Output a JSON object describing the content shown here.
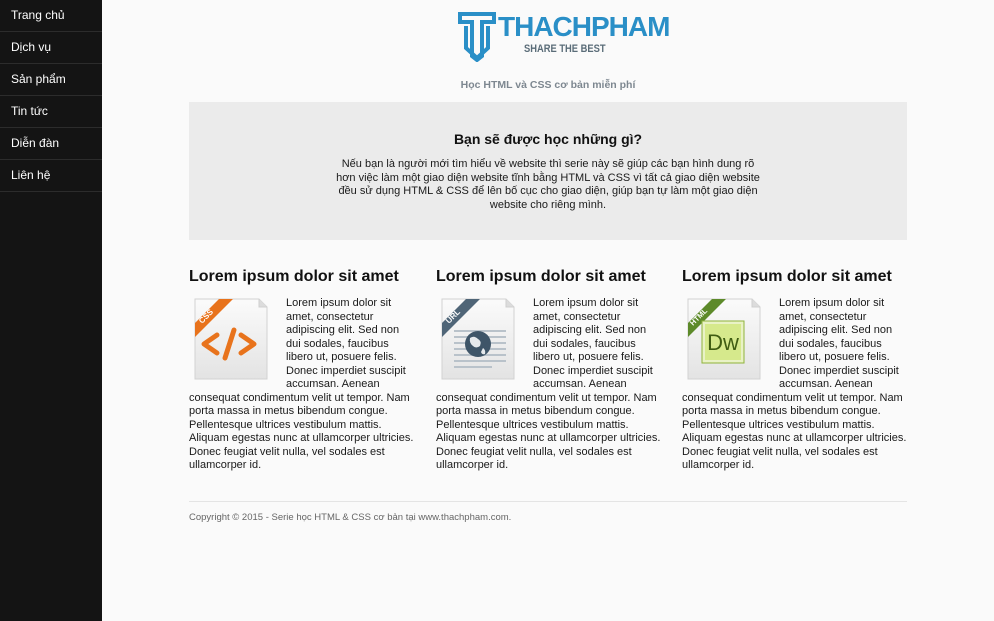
{
  "sidebar": {
    "items": [
      {
        "label": "Trang chủ"
      },
      {
        "label": "Dịch vụ"
      },
      {
        "label": "Sản phẩm"
      },
      {
        "label": "Tin tức"
      },
      {
        "label": "Diễn đàn"
      },
      {
        "label": "Liên hệ"
      }
    ]
  },
  "header": {
    "logo_brand": "THACHPHAM",
    "logo_tagline": "SHARE THE BEST",
    "subtitle": "Học HTML và CSS cơ bản miễn phí"
  },
  "intro": {
    "heading": "Bạn sẽ được học những gì?",
    "text": "Nếu bạn là người mới tìm hiểu về website thì serie này sẽ giúp các bạn hình dung rõ hơn việc làm một giao diện website tĩnh bằng HTML và CSS vì tất cả giao diện website đều sử dụng HTML & CSS để lên bố cục cho giao diện, giúp bạn tự làm một giao diện website cho riêng mình."
  },
  "columns": [
    {
      "title": "Lorem ipsum dolor sit amet",
      "icon": "css-file-icon",
      "ribbon": "CSS",
      "text": "Lorem ipsum dolor sit amet, consectetur adipiscing elit. Sed non dui sodales, faucibus libero ut, posuere felis. Donec imperdiet suscipit accumsan. Aenean consequat condimentum velit ut tempor. Nam porta massa in metus bibendum congue. Pellentesque ultrices vestibulum mattis. Aliquam egestas nunc at ullamcorper ultricies. Donec feugiat velit nulla, vel sodales est ullamcorper id."
    },
    {
      "title": "Lorem ipsum dolor sit amet",
      "icon": "url-file-icon",
      "ribbon": "URL",
      "text": "Lorem ipsum dolor sit amet, consectetur adipiscing elit. Sed non dui sodales, faucibus libero ut, posuere felis. Donec imperdiet suscipit accumsan. Aenean consequat condimentum velit ut tempor. Nam porta massa in metus bibendum congue. Pellentesque ultrices vestibulum mattis. Aliquam egestas nunc at ullamcorper ultricies. Donec feugiat velit nulla, vel sodales est ullamcorper id."
    },
    {
      "title": "Lorem ipsum dolor sit amet",
      "icon": "html-dreamweaver-file-icon",
      "ribbon": "HTML",
      "app_label": "Dw",
      "text": "Lorem ipsum dolor sit amet, consectetur adipiscing elit. Sed non dui sodales, faucibus libero ut, posuere felis. Donec imperdiet suscipit accumsan. Aenean consequat condimentum velit ut tempor. Nam porta massa in metus bibendum congue. Pellentesque ultrices vestibulum mattis. Aliquam egestas nunc at ullamcorper ultricies. Donec feugiat velit nulla, vel sodales est ullamcorper id."
    }
  ],
  "footer": {
    "copyright": "Copyright © 2015 - Serie học HTML & CSS cơ bản tại www.thachpham.com."
  },
  "colors": {
    "sidebar_bg": "#141414",
    "brand_blue": "#2a8fc7",
    "intro_bg": "#ebebeb",
    "css_orange": "#e8731c",
    "url_slate": "#4f6577",
    "html_green": "#5d8a2a"
  }
}
